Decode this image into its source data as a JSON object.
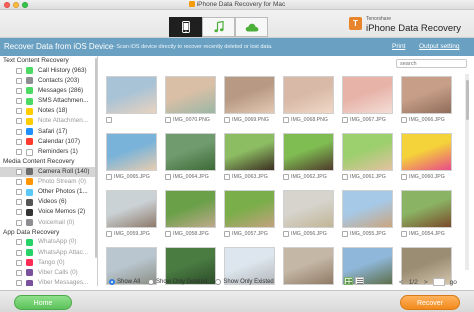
{
  "window": {
    "title": "iPhone Data Recovery for Mac"
  },
  "toolbar": {
    "tabs": [
      {
        "icon": "phone-icon",
        "active": true
      },
      {
        "icon": "music-note-icon",
        "active": false
      },
      {
        "icon": "cloud-icon",
        "active": false
      }
    ]
  },
  "brand": {
    "small": "Tenorshare",
    "title": "iPhone Data Recovery"
  },
  "banner": {
    "title": "Recover Data from iOS Device",
    "subtitle": "- Scan iOS device directly to recover recently deleted or lost data.",
    "print": "Print",
    "output_setting": "Output setting"
  },
  "sidebar": {
    "sections": [
      {
        "title": "Text Content Recovery",
        "items": [
          {
            "label": "Call History (963)",
            "color": "#4cd964",
            "dim": false
          },
          {
            "label": "Contacts (203)",
            "color": "#8e8e93",
            "dim": false
          },
          {
            "label": "Messages (286)",
            "color": "#4cd964",
            "dim": false
          },
          {
            "label": "SMS Attachmen...",
            "color": "#4cd964",
            "dim": false
          },
          {
            "label": "Notes (18)",
            "color": "#ffcc00",
            "dim": false
          },
          {
            "label": "Note Attachmen...",
            "color": "#ffcc00",
            "dim": true
          },
          {
            "label": "Safari (17)",
            "color": "#1e90ff",
            "dim": false
          },
          {
            "label": "Calendar (107)",
            "color": "#ff3b30",
            "dim": false
          },
          {
            "label": "Reminders (1)",
            "color": "#ffffff",
            "dim": false
          }
        ]
      },
      {
        "title": "Media Content Recovery",
        "items": [
          {
            "label": "Camera Roll (140)",
            "color": "#6d6d6d",
            "dim": false,
            "selected": true
          },
          {
            "label": "Photo Stream (0)",
            "color": "#ff9500",
            "dim": true
          },
          {
            "label": "Other Photos (1...",
            "color": "#5ac8fa",
            "dim": false
          },
          {
            "label": "Videos (6)",
            "color": "#555555",
            "dim": false
          },
          {
            "label": "Voice Memos (2)",
            "color": "#333333",
            "dim": false
          },
          {
            "label": "Voicemail (0)",
            "color": "#8e8e93",
            "dim": true
          }
        ]
      },
      {
        "title": "App Data Recovery",
        "items": [
          {
            "label": "WhatsApp (0)",
            "color": "#25d366",
            "dim": true
          },
          {
            "label": "WhatsApp Attac...",
            "color": "#25d366",
            "dim": true
          },
          {
            "label": "Tango (0)",
            "color": "#ff2d55",
            "dim": true
          },
          {
            "label": "Viber Calls (0)",
            "color": "#7b519d",
            "dim": true
          },
          {
            "label": "Viber Messages...",
            "color": "#7b519d",
            "dim": true
          },
          {
            "label": "App Documents...",
            "color": "#2f7de1",
            "dim": false
          }
        ]
      }
    ]
  },
  "search": {
    "placeholder": "search"
  },
  "photos": [
    {
      "name": "",
      "c1": "#a9c3d6",
      "c2": "#e9d3bf"
    },
    {
      "name": "IMG_0070.PNG",
      "c1": "#d9bfa6",
      "c2": "#9bb7a5"
    },
    {
      "name": "IMG_0069.PNG",
      "c1": "#b89a84",
      "c2": "#e4c9b4"
    },
    {
      "name": "IMG_0068.PNG",
      "c1": "#d8b8a6",
      "c2": "#f0d9c8"
    },
    {
      "name": "IMG_0067.JPG",
      "c1": "#e7b2a8",
      "c2": "#f3ded6"
    },
    {
      "name": "IMG_0066.JPG",
      "c1": "#c79f88",
      "c2": "#8f6c5a"
    },
    {
      "name": "IMG_0065.JPG",
      "c1": "#7ab3d9",
      "c2": "#e7cdb0"
    },
    {
      "name": "IMG_0064.JPG",
      "c1": "#6f9b6f",
      "c2": "#3d6a36"
    },
    {
      "name": "IMG_0063.JPG",
      "c1": "#8dbd63",
      "c2": "#3c2e22"
    },
    {
      "name": "IMG_0062.JPG",
      "c1": "#7fbc52",
      "c2": "#4f3a2b"
    },
    {
      "name": "IMG_0061.JPG",
      "c1": "#9ccf6d",
      "c2": "#e4c2a0"
    },
    {
      "name": "IMG_0060.JPG",
      "c1": "#f4d23a",
      "c2": "#e94a89"
    },
    {
      "name": "IMG_0059.JPG",
      "c1": "#cbd2d6",
      "c2": "#8e7a6a"
    },
    {
      "name": "IMG_0058.JPG",
      "c1": "#6aa048",
      "c2": "#bfa98c"
    },
    {
      "name": "IMG_0057.JPG",
      "c1": "#7aae4a",
      "c2": "#c3a27e"
    },
    {
      "name": "IMG_0056.JPG",
      "c1": "#d6d4cd",
      "c2": "#c2b596"
    },
    {
      "name": "IMG_0055.JPG",
      "c1": "#a6c9e8",
      "c2": "#caa57f"
    },
    {
      "name": "IMG_0054.JPG",
      "c1": "#8bb364",
      "c2": "#7a4a2a"
    },
    {
      "name": "",
      "c1": "#b9c6cf",
      "c2": "#8c8f86"
    },
    {
      "name": "",
      "c1": "#4a7c42",
      "c2": "#2d4c2a"
    },
    {
      "name": "",
      "c1": "#dde6ee",
      "c2": "#b3b7ba"
    },
    {
      "name": "",
      "c1": "#c4b7a5",
      "c2": "#8f7b66"
    },
    {
      "name": "",
      "c1": "#8fb7d9",
      "c2": "#5d6f4a"
    },
    {
      "name": "",
      "c1": "#9b8c74",
      "c2": "#d3c6ad"
    }
  ],
  "filters": [
    {
      "label": "Show All",
      "checked": true
    },
    {
      "label": "Show Only Deleted",
      "checked": false
    },
    {
      "label": "Show Only Existed",
      "checked": false
    }
  ],
  "pager": {
    "prev": "<",
    "page": "1/2",
    "next": ">",
    "go": "go"
  },
  "footer": {
    "home": "Home",
    "recover": "Recover"
  }
}
